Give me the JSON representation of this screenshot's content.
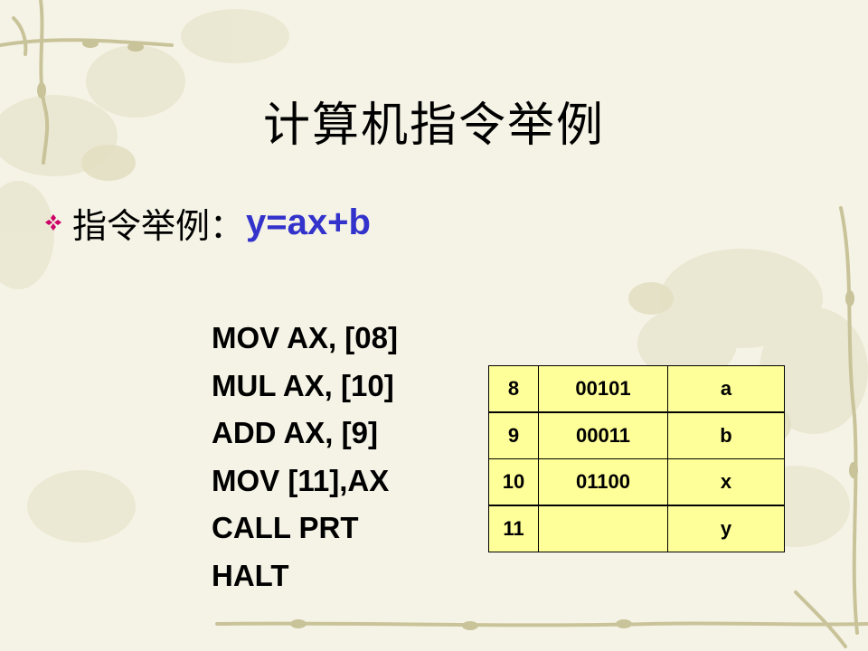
{
  "slide": {
    "title": "计算机指令举例",
    "bullet_label": "指令举例：",
    "formula": "y=ax+b",
    "code_lines": [
      "MOV AX, [08]",
      "MUL AX, [10]",
      "ADD AX, [9]",
      "MOV [11],AX",
      "CALL PRT",
      "HALT"
    ],
    "memory_table": [
      {
        "address": "8",
        "value": "00101",
        "name": "a"
      },
      {
        "address": "9",
        "value": "00011",
        "name": "b"
      },
      {
        "address": "10",
        "value": "01100",
        "name": "x"
      },
      {
        "address": "11",
        "value": "",
        "name": "y"
      }
    ]
  },
  "colors": {
    "background": "#f5f3e6",
    "bullet": "#cc0066",
    "formula": "#3333cc",
    "table_fill": "#ffff99"
  },
  "icons": {
    "bullet": "diamond-bullet-icon"
  }
}
